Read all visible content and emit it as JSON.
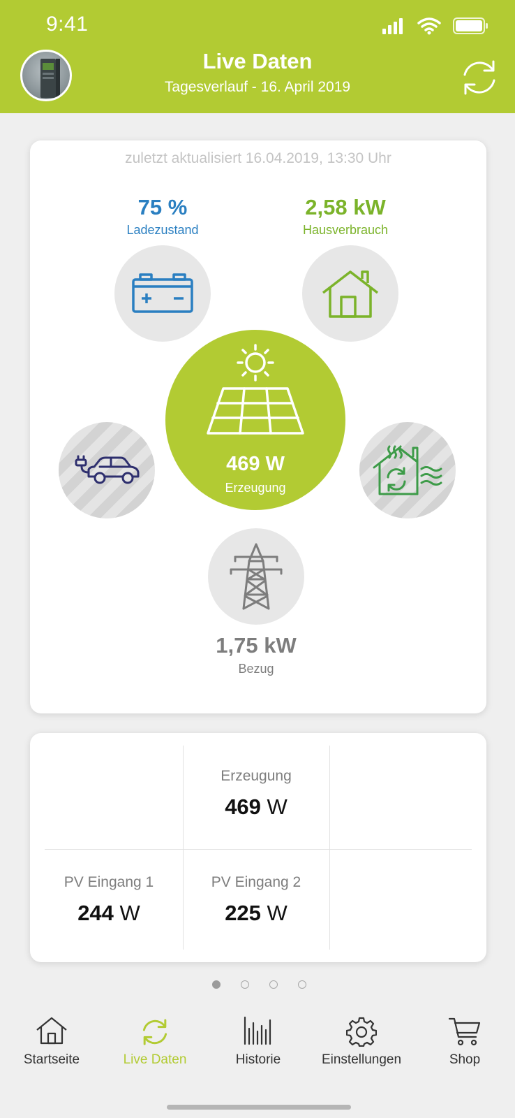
{
  "status_bar": {
    "time": "9:41"
  },
  "header": {
    "title": "Live Daten",
    "subtitle": "Tagesverlauf - 16. April 2019"
  },
  "live_card": {
    "updated_text": "zuletzt aktualisiert 16.04.2019, 13:30 Uhr",
    "battery": {
      "value": "75 %",
      "label": "Ladezustand"
    },
    "house": {
      "value": "2,58 kW",
      "label": "Hausverbrauch"
    },
    "solar": {
      "value": "469 W",
      "label": "Erzeugung"
    },
    "grid": {
      "value": "1,75 kW",
      "label": "Bezug"
    }
  },
  "stats_card": {
    "production": {
      "label": "Erzeugung",
      "number": "469",
      "unit": " W"
    },
    "pv1": {
      "label": "PV Eingang 1",
      "number": "244",
      "unit": " W"
    },
    "pv2": {
      "label": "PV Eingang 2",
      "number": "225",
      "unit": " W"
    }
  },
  "pager": {
    "pages": 4,
    "active": 0
  },
  "tabbar": {
    "items": [
      {
        "label": "Startseite",
        "icon": "home-icon"
      },
      {
        "label": "Live Daten",
        "icon": "refresh-icon"
      },
      {
        "label": "Historie",
        "icon": "history-bars-icon"
      },
      {
        "label": "Einstellungen",
        "icon": "gear-icon"
      },
      {
        "label": "Shop",
        "icon": "cart-icon"
      }
    ],
    "active_index": 1
  },
  "colors": {
    "brand_green": "#b2cb33",
    "battery_blue": "#2a7fc1",
    "house_green": "#7bb32a",
    "heat_green": "#3d9b48",
    "ev_navy": "#2e2f6e",
    "grid_gray": "#7d7d7d"
  }
}
